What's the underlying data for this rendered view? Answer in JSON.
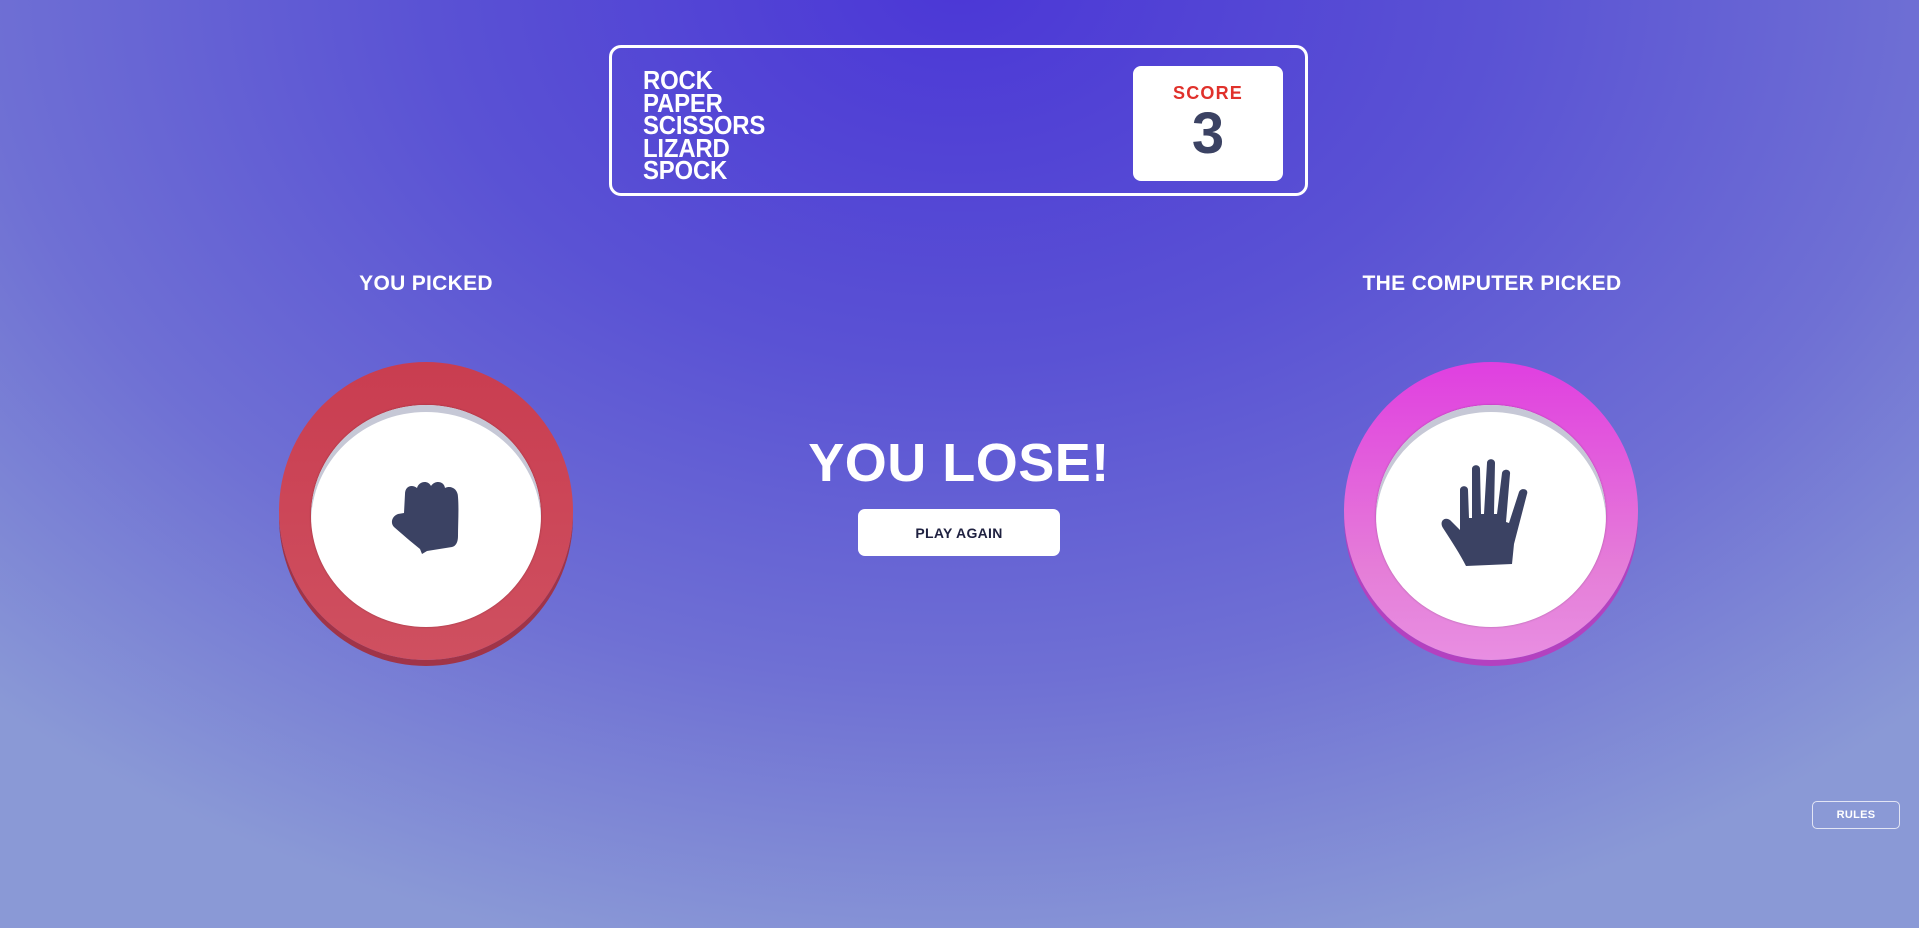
{
  "header": {
    "title_lines": [
      "ROCK",
      "PAPER",
      "SCISSORS",
      "LIZARD",
      "SPOCK"
    ],
    "score_label": "SCORE",
    "score_value": "3"
  },
  "game": {
    "player_label": "YOU PICKED",
    "computer_label": "THE COMPUTER PICKED",
    "player_pick": "rock",
    "computer_pick": "paper",
    "result": "YOU LOSE!",
    "play_again_label": "PLAY AGAIN"
  },
  "footer": {
    "rules_label": "RULES"
  },
  "colors": {
    "rock": "#c93d50",
    "paper": "#e03fe0",
    "score_label": "#e0312b",
    "dark_text": "#3b4263",
    "background_top": "#4b37d6",
    "background_bottom": "#8a99d6"
  }
}
